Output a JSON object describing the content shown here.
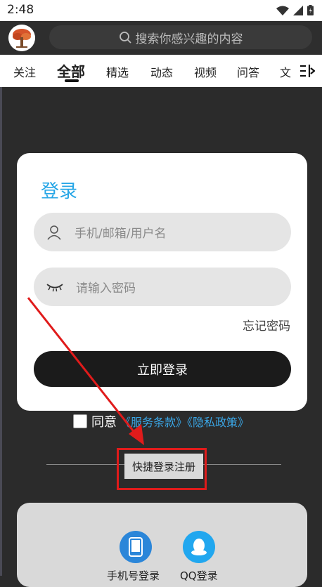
{
  "status_bar": {
    "time": "2:48"
  },
  "header": {
    "search_placeholder": "搜索你感兴趣的内容"
  },
  "tabs": [
    {
      "label": "关注"
    },
    {
      "label": "全部"
    },
    {
      "label": "精选"
    },
    {
      "label": "动态"
    },
    {
      "label": "视频"
    },
    {
      "label": "问答"
    },
    {
      "label": "文"
    }
  ],
  "login": {
    "title": "登录",
    "username_placeholder": "手机/邮箱/用户名",
    "password_placeholder": "请输入密码",
    "forgot_label": "忘记密码",
    "submit_label": "立即登录"
  },
  "agreement": {
    "label": "同意",
    "terms": "《服务条款》《隐私政策》"
  },
  "quick_register": {
    "label": "快捷登录注册"
  },
  "alt_login": [
    {
      "label": "手机号登录"
    },
    {
      "label": "QQ登录"
    }
  ],
  "colors": {
    "accent": "#27a6e6",
    "highlight": "#e01b1b",
    "annotation_arrow": "#e01b1b"
  }
}
